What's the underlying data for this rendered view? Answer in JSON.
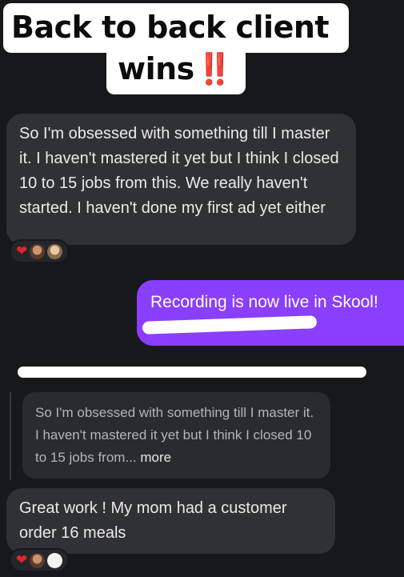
{
  "caption": {
    "line1": "Back to back client",
    "line2": "wins",
    "emphasis": "‼️"
  },
  "messages": [
    {
      "text": "So I'm obsessed with something till I master it. I haven't mastered it yet but I think I closed 10 to 15 jobs from this. We really haven't started. I haven't done my first ad yet either",
      "reactions": [
        "red-heart",
        "avatar",
        "avatar"
      ]
    },
    {
      "text": "Recording is now live in Skool!"
    },
    {
      "quoted_text": "So I'm obsessed with something till I master it. I haven't mastered it yet but I think I closed 10 to 15 jobs from...",
      "more_label": "more"
    },
    {
      "text": "Great work ! My mom had a customer order 16 meals",
      "reactions": [
        "red-heart",
        "avatar",
        "avatar"
      ]
    }
  ],
  "colors": {
    "background": "#17181b",
    "incoming_bubble": "#303135",
    "outgoing_bubble": "#8a3ffc",
    "heart": "#e3232f",
    "caption_emphasis": "#e21f26"
  }
}
